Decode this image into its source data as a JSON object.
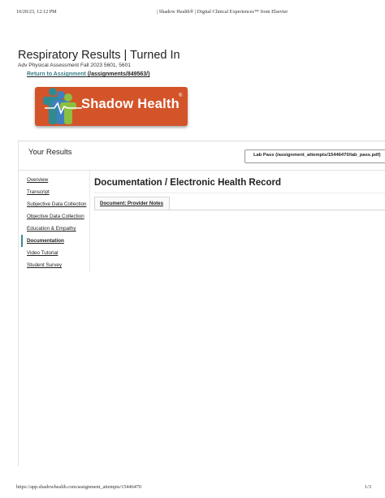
{
  "print_header": {
    "datetime": "10/20/23, 12:12 PM",
    "document_title": "| Shadow Health®  |  Digital Clinical Experiences™ from Elsevier"
  },
  "page": {
    "title": "Respiratory Results | Turned In",
    "subtitle": "Adv Physical Assessment Fall 2023 5601, 5601",
    "return_link": {
      "label": "Return to Assignment",
      "path": "(/assignments/849563/)"
    }
  },
  "logo": {
    "wordmark": "Shadow Health",
    "registered": "®",
    "colors": {
      "plate": "#d4542a",
      "teal": "#2f8a92",
      "green": "#8bbf3f",
      "blue": "#3f7fbf"
    }
  },
  "results": {
    "heading": "Your Results",
    "lab_pass_button": "Lab Pass (/assignment_attempts/15446470/lab_pass.pdf)"
  },
  "sidebar": {
    "items": [
      {
        "label": "Overview",
        "active": false
      },
      {
        "label": "Transcript",
        "active": false
      },
      {
        "label": "Subjective Data Collection",
        "active": false
      },
      {
        "label": "Objective Data Collection",
        "active": false
      },
      {
        "label": "Education & Empathy",
        "active": false
      },
      {
        "label": "Documentation",
        "active": true
      },
      {
        "label": "Video Tutorial",
        "active": false
      },
      {
        "label": "Student Survey",
        "active": false
      }
    ]
  },
  "documentation": {
    "title": "Documentation / Electronic Health Record",
    "tabs": [
      {
        "label": "Document: Provider Notes"
      }
    ]
  },
  "print_footer": {
    "url": "https://app.shadowhealth.com/assignment_attempts/15446470",
    "page_number": "1/3"
  },
  "colors": {
    "accent": "#3a8d93",
    "link": "#3a7f8a"
  }
}
